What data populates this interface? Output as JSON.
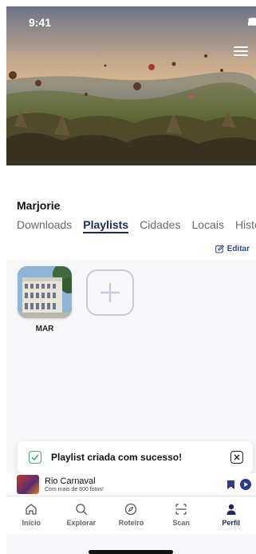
{
  "status": {
    "time": "9:41"
  },
  "profile": {
    "name": "Marjorie"
  },
  "tabs": [
    {
      "label": "Downloads",
      "active": false
    },
    {
      "label": "Playlists",
      "active": true
    },
    {
      "label": "Cidades",
      "active": false
    },
    {
      "label": "Locais",
      "active": false
    },
    {
      "label": "Histó",
      "active": false
    }
  ],
  "edit": {
    "label": "Editar"
  },
  "playlists": [
    {
      "label": "MAR"
    }
  ],
  "toast": {
    "message": "Playlist criada com sucesso!"
  },
  "mini_player": {
    "title": "Rio Carnaval",
    "subtitle": "Com mais de 800 fotos!"
  },
  "nav": [
    {
      "label": "Início",
      "icon": "home-icon",
      "active": false
    },
    {
      "label": "Explorar",
      "icon": "search-icon",
      "active": false
    },
    {
      "label": "Roteiro",
      "icon": "compass-icon",
      "active": false
    },
    {
      "label": "Scan",
      "icon": "scan-icon",
      "active": false
    },
    {
      "label": "Perfil",
      "icon": "profile-icon",
      "active": true
    }
  ],
  "colors": {
    "accent": "#1f2a5c",
    "success": "#3bb66b",
    "edit": "#3b4a8a"
  }
}
